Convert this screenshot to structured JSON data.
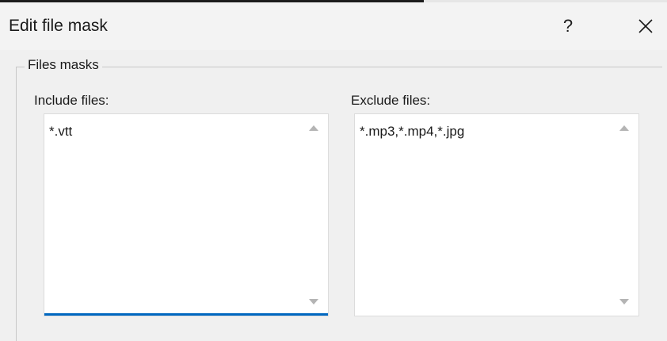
{
  "dialog": {
    "title": "Edit file mask",
    "help_glyph": "?",
    "close_icon": "close-icon"
  },
  "group": {
    "label": "Files masks"
  },
  "include": {
    "label": "Include files:",
    "value": "*.vtt"
  },
  "exclude": {
    "label": "Exclude files:",
    "value": "*.mp3,*.mp4,*.jpg"
  },
  "colors": {
    "focus_accent": "#0067c0",
    "background": "#f0f0f0"
  }
}
